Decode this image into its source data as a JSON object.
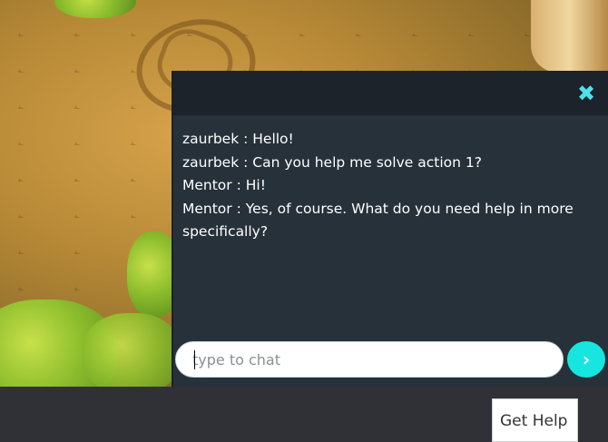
{
  "chat": {
    "close_icon": "close-icon",
    "messages": [
      {
        "text": "zaurbek : Hello!"
      },
      {
        "text": "zaurbek : Can you help me solve action 1?"
      },
      {
        "text": "Mentor : Hi!"
      },
      {
        "text": "Mentor : Yes, of course. What do you need help in more specifically?"
      }
    ],
    "input": {
      "placeholder": "type to chat",
      "value": ""
    },
    "send_icon": "chevron-right-icon"
  },
  "footer": {
    "get_help_label": "Get Help"
  },
  "colors": {
    "chat_bg": "#27313a",
    "chat_header_bg": "#1d232b",
    "accent": "#17e5e0",
    "page_bg": "#2f3136"
  }
}
